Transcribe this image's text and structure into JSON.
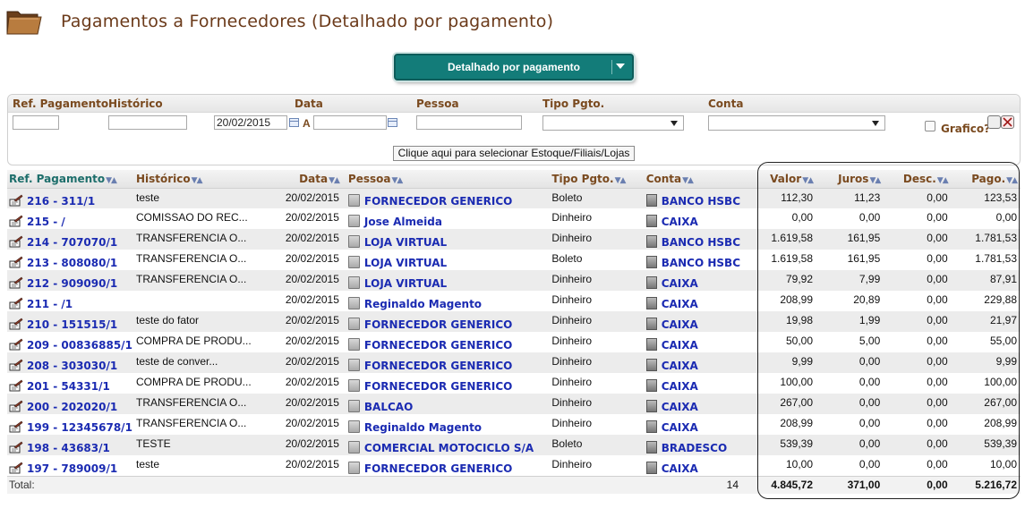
{
  "header": {
    "title": "Pagamentos a Fornecedores (Detalhado por pagamento)"
  },
  "view_select": {
    "label": "Detalhado por pagamento"
  },
  "filters": {
    "labels": {
      "ref": "Ref. Pagamento",
      "historico": "Histórico",
      "data": "Data",
      "pessoa": "Pessoa",
      "tipo": "Tipo Pgto.",
      "conta": "Conta"
    },
    "ref_value": "",
    "historico_value": "",
    "date_from": "20/02/2015",
    "date_sep": "A",
    "date_to": "",
    "pessoa_value": "",
    "tipo_value": "",
    "conta_value": "",
    "grafico_label": "Grafico?",
    "stock_button": "Clique aqui para selecionar Estoque/Filiais/Lojas"
  },
  "table": {
    "columns": [
      "Ref. Pagamento",
      "Histórico",
      "Data",
      "Pessoa",
      "Tipo Pgto.",
      "Conta",
      "Valor",
      "Juros",
      "Desc.",
      "Pago."
    ],
    "rows": [
      {
        "ref": "216 - 311/1",
        "hist": "teste",
        "data": "20/02/2015",
        "pessoa": "FORNECEDOR GENERICO",
        "tipo": "Boleto",
        "conta": "BANCO HSBC",
        "valor": "112,30",
        "juros": "11,23",
        "desc": "0,00",
        "pago": "123,53"
      },
      {
        "ref": "215 - /",
        "hist": "COMISSAO DO REC...",
        "data": "20/02/2015",
        "pessoa": "Jose Almeida",
        "tipo": "Dinheiro",
        "conta": "CAIXA",
        "valor": "0,00",
        "juros": "0,00",
        "desc": "0,00",
        "pago": "0,00"
      },
      {
        "ref": "214 - 707070/1",
        "hist": "TRANSFERENCIA O...",
        "data": "20/02/2015",
        "pessoa": "LOJA VIRTUAL",
        "tipo": "Dinheiro",
        "conta": "BANCO HSBC",
        "valor": "1.619,58",
        "juros": "161,95",
        "desc": "0,00",
        "pago": "1.781,53"
      },
      {
        "ref": "213 - 808080/1",
        "hist": "TRANSFERENCIA O...",
        "data": "20/02/2015",
        "pessoa": "LOJA VIRTUAL",
        "tipo": "Boleto",
        "conta": "BANCO HSBC",
        "valor": "1.619,58",
        "juros": "161,95",
        "desc": "0,00",
        "pago": "1.781,53"
      },
      {
        "ref": "212 - 909090/1",
        "hist": "TRANSFERENCIA O...",
        "data": "20/02/2015",
        "pessoa": "LOJA VIRTUAL",
        "tipo": "Dinheiro",
        "conta": "CAIXA",
        "valor": "79,92",
        "juros": "7,99",
        "desc": "0,00",
        "pago": "87,91"
      },
      {
        "ref": "211 - /1",
        "hist": "",
        "data": "20/02/2015",
        "pessoa": "Reginaldo Magento",
        "tipo": "Dinheiro",
        "conta": "CAIXA",
        "valor": "208,99",
        "juros": "20,89",
        "desc": "0,00",
        "pago": "229,88"
      },
      {
        "ref": "210 - 151515/1",
        "hist": "teste do fator",
        "data": "20/02/2015",
        "pessoa": "FORNECEDOR GENERICO",
        "tipo": "Dinheiro",
        "conta": "CAIXA",
        "valor": "19,98",
        "juros": "1,99",
        "desc": "0,00",
        "pago": "21,97"
      },
      {
        "ref": "209 - 00836885/1",
        "hist": "COMPRA DE PRODU...",
        "data": "20/02/2015",
        "pessoa": "FORNECEDOR GENERICO",
        "tipo": "Dinheiro",
        "conta": "CAIXA",
        "valor": "50,00",
        "juros": "5,00",
        "desc": "0,00",
        "pago": "55,00"
      },
      {
        "ref": "208 - 303030/1",
        "hist": "teste de conver...",
        "data": "20/02/2015",
        "pessoa": "FORNECEDOR GENERICO",
        "tipo": "Dinheiro",
        "conta": "CAIXA",
        "valor": "9,99",
        "juros": "0,00",
        "desc": "0,00",
        "pago": "9,99"
      },
      {
        "ref": "201 - 54331/1",
        "hist": "COMPRA DE PRODU...",
        "data": "20/02/2015",
        "pessoa": "FORNECEDOR GENERICO",
        "tipo": "Dinheiro",
        "conta": "CAIXA",
        "valor": "100,00",
        "juros": "0,00",
        "desc": "0,00",
        "pago": "100,00"
      },
      {
        "ref": "200 - 202020/1",
        "hist": "TRANSFERENCIA O...",
        "data": "20/02/2015",
        "pessoa": "BALCAO",
        "tipo": "Dinheiro",
        "conta": "CAIXA",
        "valor": "267,00",
        "juros": "0,00",
        "desc": "0,00",
        "pago": "267,00"
      },
      {
        "ref": "199 - 12345678/1",
        "hist": "TRANSFERENCIA O...",
        "data": "20/02/2015",
        "pessoa": "Reginaldo Magento",
        "tipo": "Dinheiro",
        "conta": "CAIXA",
        "valor": "208,99",
        "juros": "0,00",
        "desc": "0,00",
        "pago": "208,99"
      },
      {
        "ref": "198 - 43683/1",
        "hist": "TESTE",
        "data": "20/02/2015",
        "pessoa": "COMERCIAL MOTOCICLO S/A",
        "tipo": "Boleto",
        "conta": "BRADESCO",
        "valor": "539,39",
        "juros": "0,00",
        "desc": "0,00",
        "pago": "539,39"
      },
      {
        "ref": "197 - 789009/1",
        "hist": "teste",
        "data": "20/02/2015",
        "pessoa": "FORNECEDOR GENERICO",
        "tipo": "Dinheiro",
        "conta": "CAIXA",
        "valor": "10,00",
        "juros": "0,00",
        "desc": "0,00",
        "pago": "10,00"
      }
    ],
    "total": {
      "label": "Total:",
      "count": "14",
      "valor": "4.845,72",
      "juros": "371,00",
      "desc": "0,00",
      "pago": "5.216,72"
    }
  },
  "icons": {
    "header": "folder-icon",
    "row": "payment-icon",
    "person": "person-icon",
    "account": "bank-icon"
  }
}
